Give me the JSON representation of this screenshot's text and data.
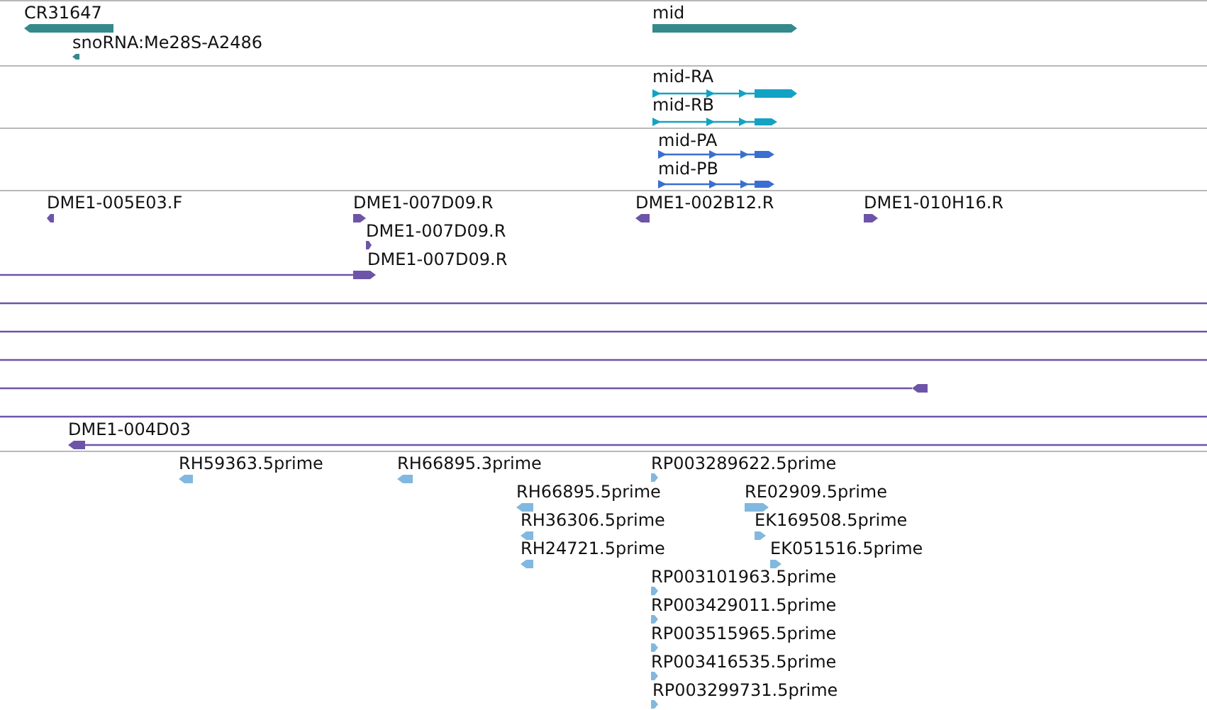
{
  "tracks": [
    {
      "kind": "gene",
      "color": "#35898a",
      "features": [
        {
          "label": "CR31647",
          "reverse": true
        },
        {
          "label": "snoRNA:Me28S-A2486",
          "reverse": true
        },
        {
          "label": "mid",
          "reverse": false
        }
      ]
    },
    {
      "kind": "transcript",
      "color": "#14a2c4",
      "features": [
        {
          "label": "mid-RA",
          "reverse": false
        },
        {
          "label": "mid-RB",
          "reverse": false
        }
      ]
    },
    {
      "kind": "protein",
      "color": "#3a6fd0",
      "features": [
        {
          "label": "mid-PA",
          "reverse": false
        },
        {
          "label": "mid-PB",
          "reverse": false
        }
      ]
    },
    {
      "kind": "clone",
      "color": "#6e54a8",
      "features": [
        {
          "label": "DME1-005E03.F",
          "reverse": true
        },
        {
          "label": "DME1-007D09.R",
          "reverse": false
        },
        {
          "label": "DME1-007D09.R",
          "reverse": false
        },
        {
          "label": "DME1-007D09.R",
          "reverse": false
        },
        {
          "label": "DME1-002B12.R",
          "reverse": true
        },
        {
          "label": "DME1-010H16.R",
          "reverse": false
        },
        {
          "reverse": true
        },
        {
          "label": "DME1-004D03",
          "reverse": true
        }
      ]
    },
    {
      "kind": "est",
      "color": "#82b8df",
      "features": [
        {
          "label": "RH59363.5prime",
          "reverse": true
        },
        {
          "label": "RH66895.3prime",
          "reverse": true
        },
        {
          "label": "RP003289622.5prime",
          "reverse": false
        },
        {
          "label": "RH66895.5prime",
          "reverse": true
        },
        {
          "label": "RE02909.5prime",
          "reverse": false
        },
        {
          "label": "RH36306.5prime",
          "reverse": true
        },
        {
          "label": "EK169508.5prime",
          "reverse": false
        },
        {
          "label": "RH24721.5prime",
          "reverse": true
        },
        {
          "label": "EK051516.5prime",
          "reverse": false
        },
        {
          "label": "RP003101963.5prime",
          "reverse": false
        },
        {
          "label": "RP003429011.5prime",
          "reverse": false
        },
        {
          "label": "RP003515965.5prime",
          "reverse": false
        },
        {
          "label": "RP003416535.5prime",
          "reverse": false
        },
        {
          "label": "RP003299731.5prime",
          "reverse": false
        }
      ]
    }
  ]
}
